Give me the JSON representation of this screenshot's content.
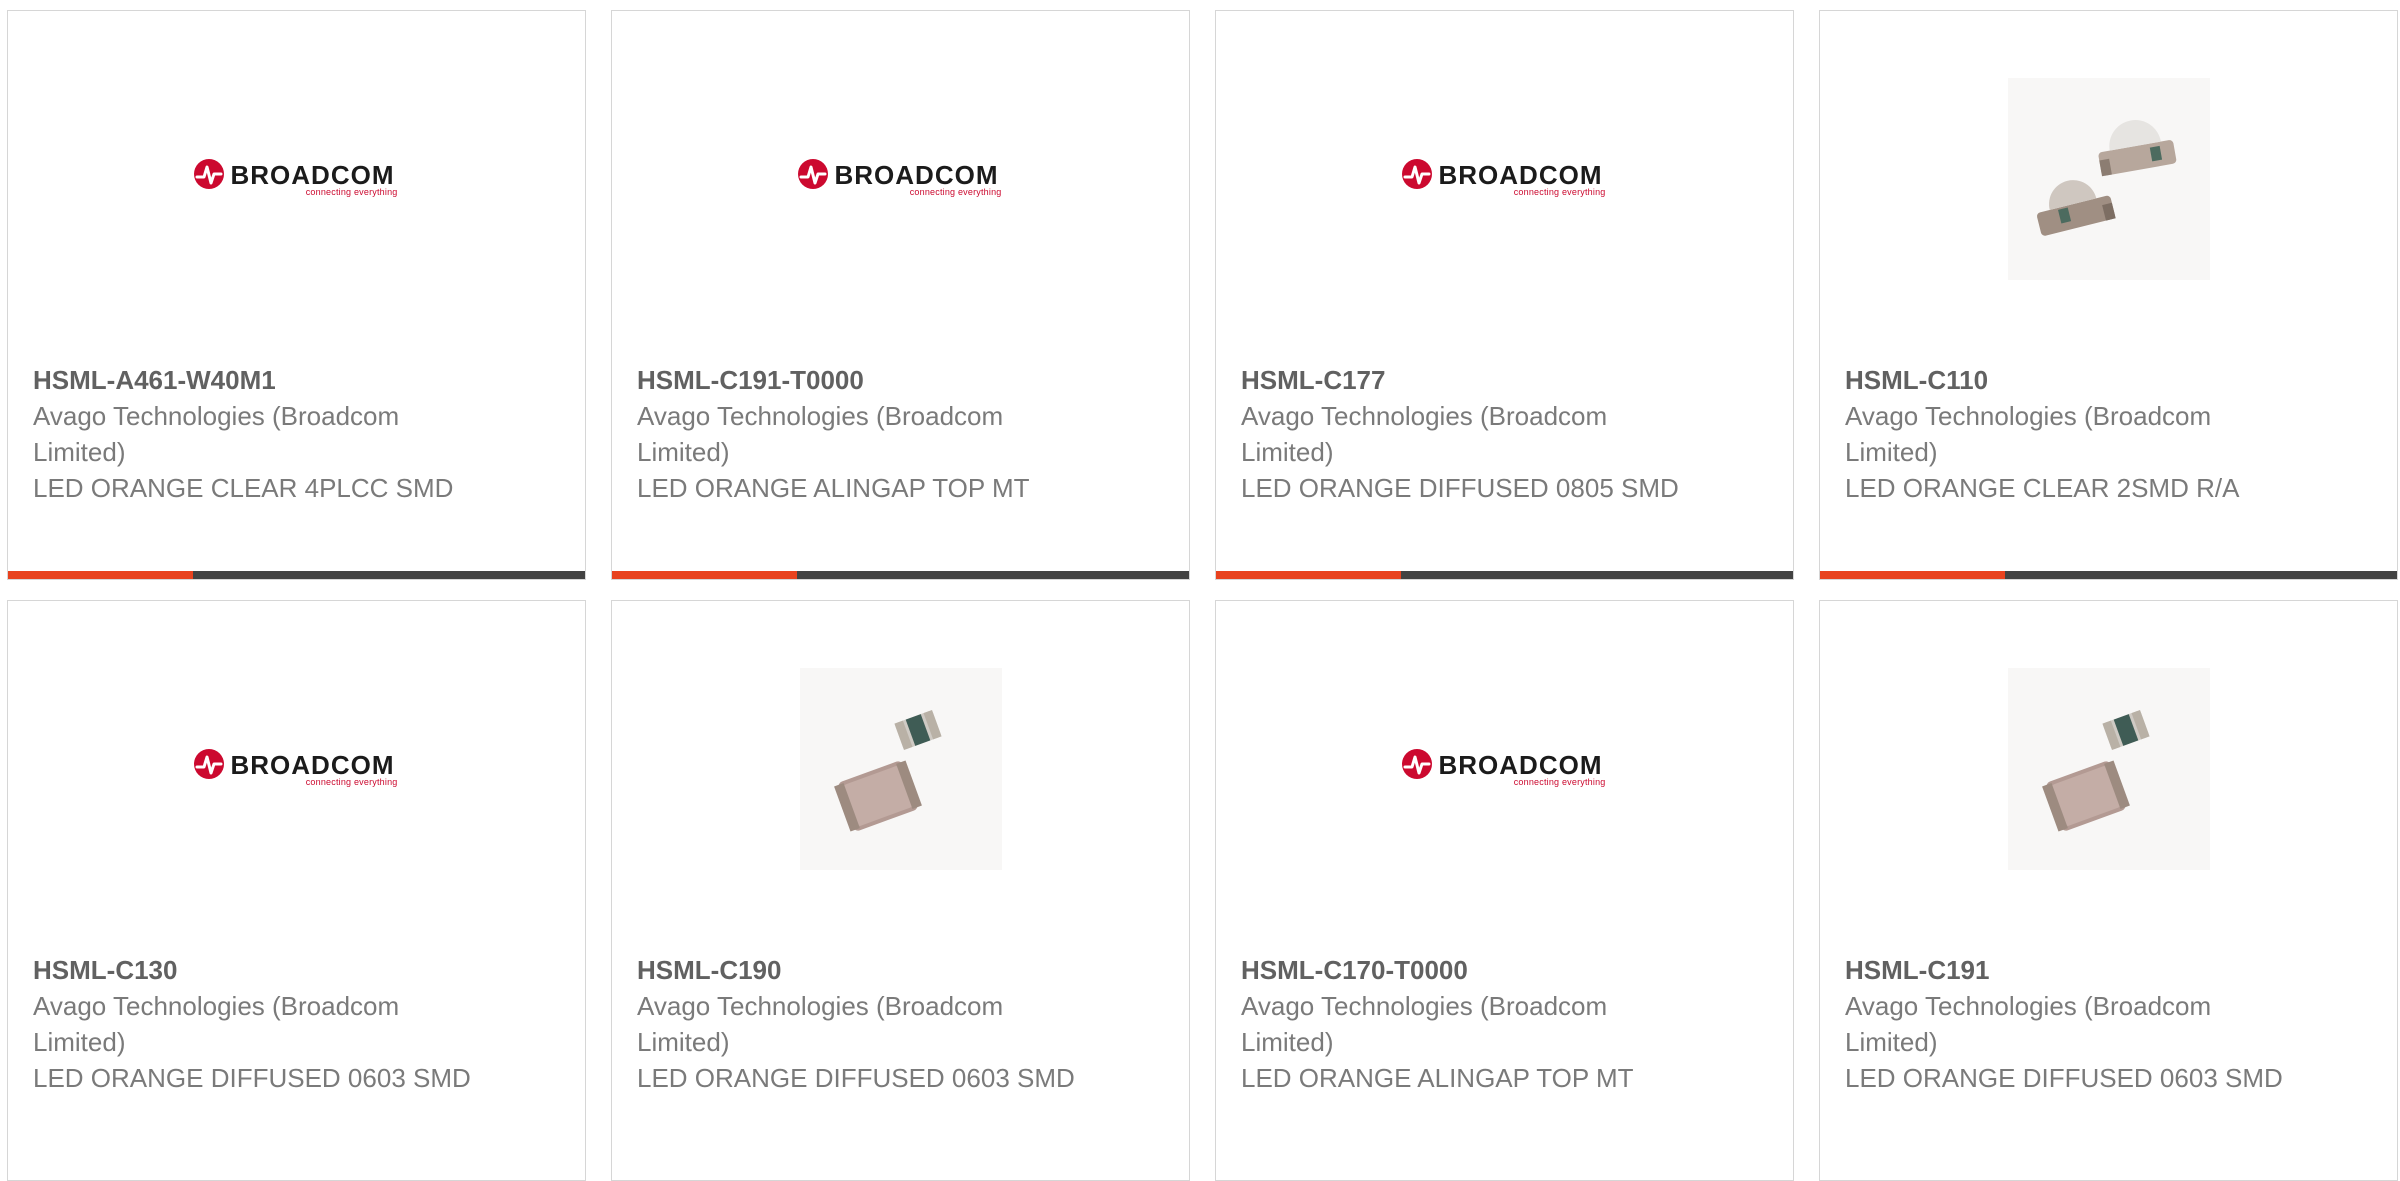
{
  "colors": {
    "accent": "#e8421e",
    "bar": "#424242",
    "broadcom_red": "#cc092f",
    "card_border": "#d6d6d6"
  },
  "logo": {
    "word": "BROADCOM",
    "tagline": "connecting everything"
  },
  "products": [
    {
      "part": "HSML-A461-W40M1",
      "mfr": "Avago Technologies (Broadcom Limited)",
      "desc": "LED ORANGE CLEAR 4PLCC SMD",
      "image": "broadcom-logo",
      "progress": 0.32
    },
    {
      "part": "HSML-C191-T0000",
      "mfr": "Avago Technologies (Broadcom Limited)",
      "desc": "LED ORANGE ALINGAP TOP MT",
      "image": "broadcom-logo",
      "progress": 0.32
    },
    {
      "part": "HSML-C177",
      "mfr": "Avago Technologies (Broadcom Limited)",
      "desc": "LED ORANGE DIFFUSED 0805 SMD",
      "image": "broadcom-logo",
      "progress": 0.32
    },
    {
      "part": "HSML-C110",
      "mfr": "Avago Technologies (Broadcom Limited)",
      "desc": "LED ORANGE CLEAR 2SMD R/A",
      "image": "led-right-angle-photo",
      "progress": 0.32
    },
    {
      "part": "HSML-C130",
      "mfr": "Avago Technologies (Broadcom Limited)",
      "desc": "LED ORANGE DIFFUSED 0603 SMD",
      "image": "broadcom-logo"
    },
    {
      "part": "HSML-C190",
      "mfr": "Avago Technologies (Broadcom Limited)",
      "desc": "LED ORANGE DIFFUSED 0603 SMD",
      "image": "led-chip-photo"
    },
    {
      "part": "HSML-C170-T0000",
      "mfr": "Avago Technologies (Broadcom Limited)",
      "desc": "LED ORANGE ALINGAP TOP MT",
      "image": "broadcom-logo"
    },
    {
      "part": "HSML-C191",
      "mfr": "Avago Technologies (Broadcom Limited)",
      "desc": "LED ORANGE DIFFUSED 0603 SMD",
      "image": "led-chip-photo"
    }
  ]
}
